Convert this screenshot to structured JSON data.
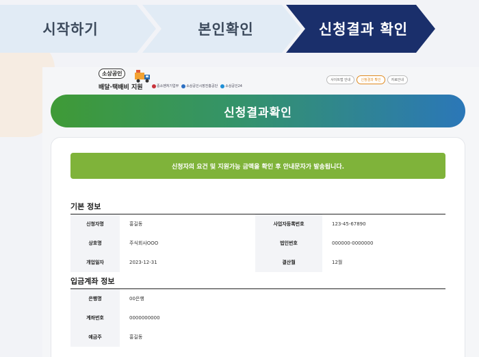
{
  "stepper": {
    "steps": [
      {
        "label": "시작하기",
        "active": false
      },
      {
        "label": "본인확인",
        "active": false
      },
      {
        "label": "신청결과 확인",
        "active": true
      }
    ]
  },
  "mini_header": {
    "badge": "소상공인",
    "title": "배달·택배비 지원",
    "orgs": [
      "중소벤처기업부",
      "소상공인시장진흥공단",
      "소상공인24"
    ],
    "buttons": [
      "사이트맵 안내",
      "신청결과 확인",
      "자료안내"
    ]
  },
  "banner": {
    "title": "신청결과확인"
  },
  "notice": {
    "text": "신청자의 요건 및 지원가능 금액을 확인 후 안내문자가 발송됩니다."
  },
  "basic_info": {
    "title": "기본 정보",
    "rows": [
      {
        "l1": "신청자명",
        "v1": "홍길동",
        "l2": "사업자등록번호",
        "v2": "123-45-67890"
      },
      {
        "l1": "상호명",
        "v1": "주식회사OOO",
        "l2": "법인번호",
        "v2": "000000-0000000"
      },
      {
        "l1": "개업일자",
        "v1": "2023-12-31",
        "l2": "결산월",
        "v2": "12월"
      }
    ]
  },
  "account_info": {
    "title": "입금계좌 정보",
    "rows": [
      {
        "label": "은행명",
        "value": "00은행"
      },
      {
        "label": "계좌번호",
        "value": "0000000000"
      },
      {
        "label": "예금주",
        "value": "홍길동"
      }
    ]
  },
  "colors": {
    "step_active": "#1a2f6b",
    "step_inactive": "#e1ebf5",
    "notice_bg": "#7fb33a",
    "banner_start": "#3f9a36",
    "banner_end": "#2b77b8"
  }
}
